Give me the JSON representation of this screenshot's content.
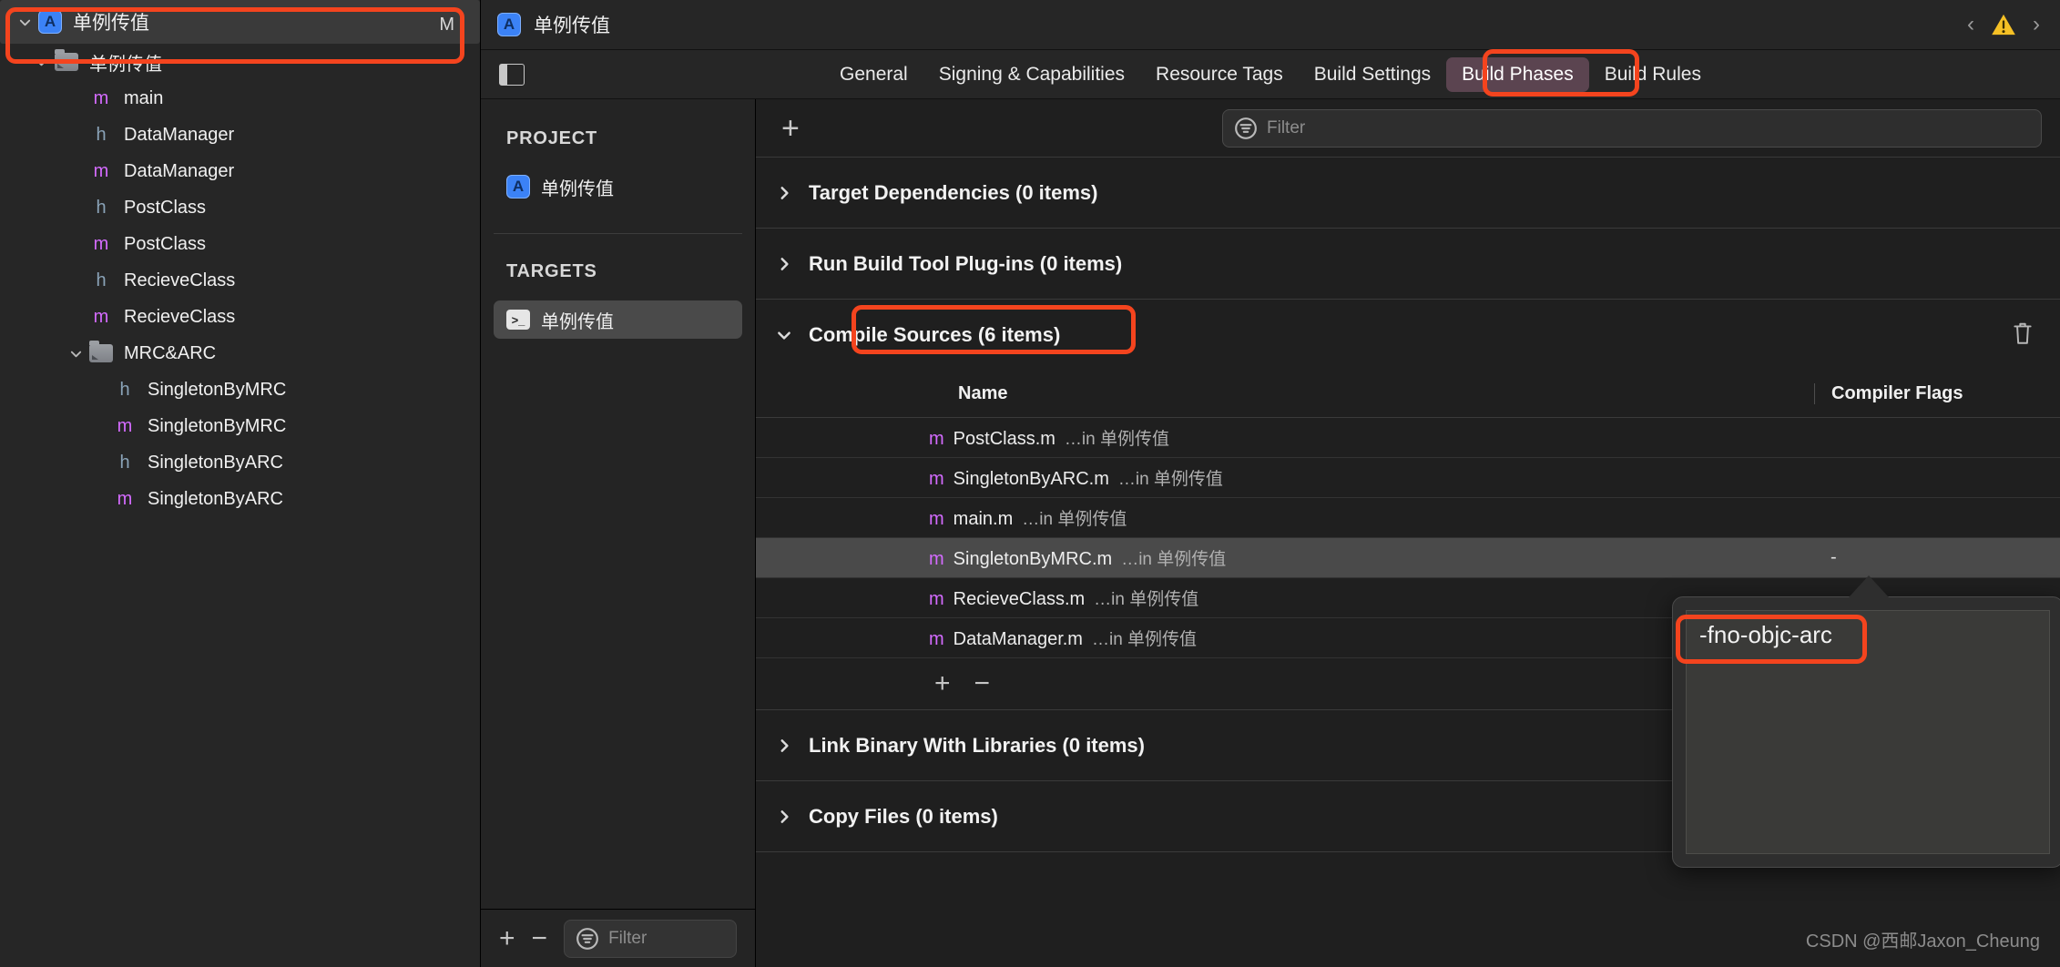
{
  "navigator": {
    "root": {
      "label": "单例传值",
      "badge": "M",
      "icon": "app-store-icon",
      "twisty": "chevron-down-icon"
    },
    "items": [
      {
        "label": "单例传值",
        "kind": "folder",
        "indent": 1,
        "twisty": "chevron-down-icon"
      },
      {
        "label": "main",
        "kind": "m",
        "indent": 2
      },
      {
        "label": "DataManager",
        "kind": "h",
        "indent": 2
      },
      {
        "label": "DataManager",
        "kind": "m",
        "indent": 2
      },
      {
        "label": "PostClass",
        "kind": "h",
        "indent": 2
      },
      {
        "label": "PostClass",
        "kind": "m",
        "indent": 2
      },
      {
        "label": "RecieveClass",
        "kind": "h",
        "indent": 2
      },
      {
        "label": "RecieveClass",
        "kind": "m",
        "indent": 2
      },
      {
        "label": "MRC&ARC",
        "kind": "folder",
        "indent": 2,
        "twisty": "chevron-down-icon"
      },
      {
        "label": "SingletonByMRC",
        "kind": "h",
        "indent": 3
      },
      {
        "label": "SingletonByMRC",
        "kind": "m",
        "indent": 3
      },
      {
        "label": "SingletonByARC",
        "kind": "h",
        "indent": 3
      },
      {
        "label": "SingletonByARC",
        "kind": "m",
        "indent": 3
      }
    ]
  },
  "editor": {
    "document_title": "单例传值",
    "nav_back": "‹",
    "nav_forward": "›",
    "warning_icon": "warning-triangle-icon",
    "tabs": [
      {
        "label": "General",
        "selected": false
      },
      {
        "label": "Signing & Capabilities",
        "selected": false
      },
      {
        "label": "Resource Tags",
        "selected": false
      },
      {
        "label": "Build Settings",
        "selected": false
      },
      {
        "label": "Build Phases",
        "selected": true
      },
      {
        "label": "Build Rules",
        "selected": false
      }
    ]
  },
  "target_pane": {
    "project_header": "PROJECT",
    "project_item": "单例传值",
    "targets_header": "TARGETS",
    "target_item": "单例传值",
    "add_label": "+",
    "remove_label": "−",
    "filter_placeholder": "Filter"
  },
  "content": {
    "add_phase_label": "+",
    "filter_placeholder": "Filter",
    "phases": [
      {
        "title": "Target Dependencies (0 items)",
        "expanded": false
      },
      {
        "title": "Run Build Tool Plug-ins (0 items)",
        "expanded": false
      },
      {
        "title": "Compile Sources (6 items)",
        "expanded": true
      },
      {
        "title": "Link Binary With Libraries (0 items)",
        "expanded": false
      },
      {
        "title": "Copy Files (0 items)",
        "expanded": false
      }
    ],
    "compile_sources": {
      "columns": {
        "name": "Name",
        "flags": "Compiler Flags"
      },
      "rows": [
        {
          "type": "m",
          "name": "PostClass.m",
          "location": "…in 单例传值",
          "flags": "",
          "selected": false
        },
        {
          "type": "m",
          "name": "SingletonByARC.m",
          "location": "…in 单例传值",
          "flags": "",
          "selected": false
        },
        {
          "type": "m",
          "name": "main.m",
          "location": "…in 单例传值",
          "flags": "",
          "selected": false
        },
        {
          "type": "m",
          "name": "SingletonByMRC.m",
          "location": "…in 单例传值",
          "flags": "-",
          "selected": true
        },
        {
          "type": "m",
          "name": "RecieveClass.m",
          "location": "…in 单例传值",
          "flags": "",
          "selected": false
        },
        {
          "type": "m",
          "name": "DataManager.m",
          "location": "…in 单例传值",
          "flags": "",
          "selected": false
        }
      ],
      "add_label": "+",
      "remove_label": "−",
      "delete_icon": "trash-icon"
    }
  },
  "popover": {
    "flag_value": "-fno-objc-arc"
  },
  "watermark": "CSDN @西邮Jaxon_Cheung",
  "colors": {
    "annotation": "#f4441e",
    "selected_tab": "#5b4450",
    "accent_blue": "#3b82f6",
    "m_file": "#d46bff",
    "h_file": "#8aa3b8"
  }
}
